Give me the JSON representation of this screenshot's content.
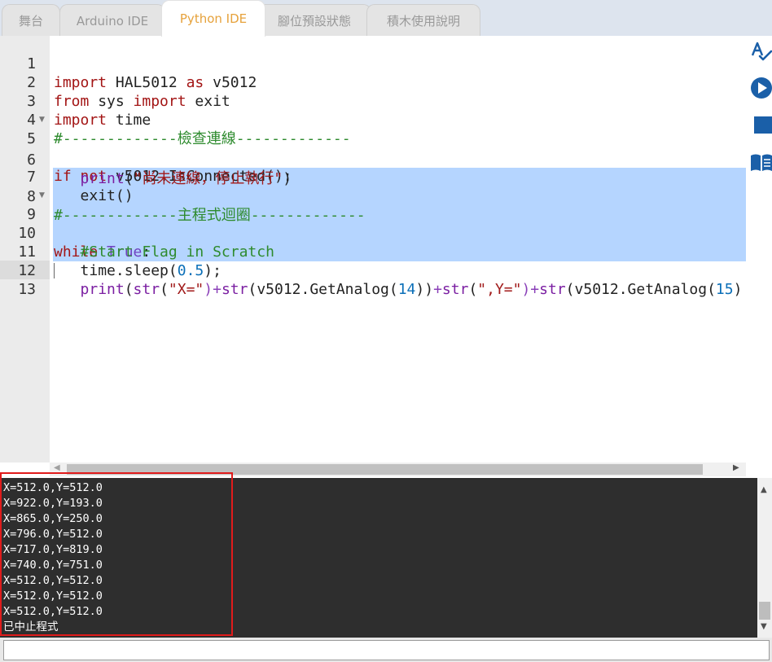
{
  "tabs": [
    {
      "label": "舞台",
      "active": false
    },
    {
      "label": "Arduino IDE",
      "active": false
    },
    {
      "label": "Python IDE",
      "active": true
    },
    {
      "label": "腳位預設狀態",
      "active": false
    },
    {
      "label": "積木使用說明",
      "active": false
    }
  ],
  "editor": {
    "line_numbers": [
      "1",
      "2",
      "3",
      "4",
      "5",
      "6",
      "7",
      "8",
      "9",
      "10",
      "11",
      "12",
      "13"
    ],
    "lines": {
      "l1": {
        "kw1": "import",
        "t1": " HAL5012 ",
        "kw2": "as",
        "t2": " v5012"
      },
      "l2": {
        "kw1": "from",
        "t1": " sys ",
        "kw2": "import",
        "t2": " exit"
      },
      "l3": {
        "kw1": "import",
        "t1": " time"
      },
      "l4": {
        "comment": "#-------------檢查連線-------------"
      },
      "l5": {
        "kw1": "if",
        "t1": " ",
        "kw2": "not",
        "t2": " v5012.IsConnected():"
      },
      "l6": {
        "indent": "   ",
        "fn": "print",
        "p1": "(",
        "str": "\"尚未連線，停止執行\"",
        "p2": ")"
      },
      "l7": {
        "indent": "   ",
        "t1": "exit()"
      },
      "l8": {
        "comment": "#-------------主程式迴圈-------------"
      },
      "l9": {
        "kw1": "while",
        "t1": " ",
        "kw2": "True",
        "t2": ":"
      },
      "l10": {
        "indent": "   ",
        "comment": "#Start Flag in Scratch"
      },
      "l11": {
        "indent": "   ",
        "t1": "time.sleep(",
        "num": "0.5",
        "t2": ");"
      },
      "l12": {
        "indent": "   ",
        "fn1": "print",
        "o1": "(",
        "fn2": "str",
        "o2": "(",
        "s1": "\"X=\"",
        "o3": ")+",
        "fn3": "str",
        "o4": "(",
        "t1": "v5012.GetAnalog(",
        "n1": "14",
        "t2": "))",
        "o5": "+",
        "fn4": "str",
        "o6": "(",
        "s2": "\",Y=\"",
        "o7": ")+",
        "fn5": "str",
        "o8": "(",
        "t3": "v5012.GetAnalog(",
        "n2": "15",
        "t4": ")"
      },
      "l13": {
        "t1": ""
      }
    }
  },
  "toolbar_icons": [
    "spellcheck-icon",
    "run-icon",
    "stop-icon",
    "book-icon"
  ],
  "console": {
    "lines": [
      "X=512.0,Y=512.0",
      "X=922.0,Y=193.0",
      "X=865.0,Y=250.0",
      "X=796.0,Y=512.0",
      "X=717.0,Y=819.0",
      "X=740.0,Y=751.0",
      "X=512.0,Y=512.0",
      "X=512.0,Y=512.0",
      "X=512.0,Y=512.0",
      "已中止程式"
    ]
  },
  "input": {
    "value": "",
    "placeholder": ""
  },
  "colors": {
    "accent_tab": "#e6a23c",
    "console_bg": "#2e2e2e",
    "selection": "#b5d5ff",
    "highlight_border": "#e01b1b"
  }
}
